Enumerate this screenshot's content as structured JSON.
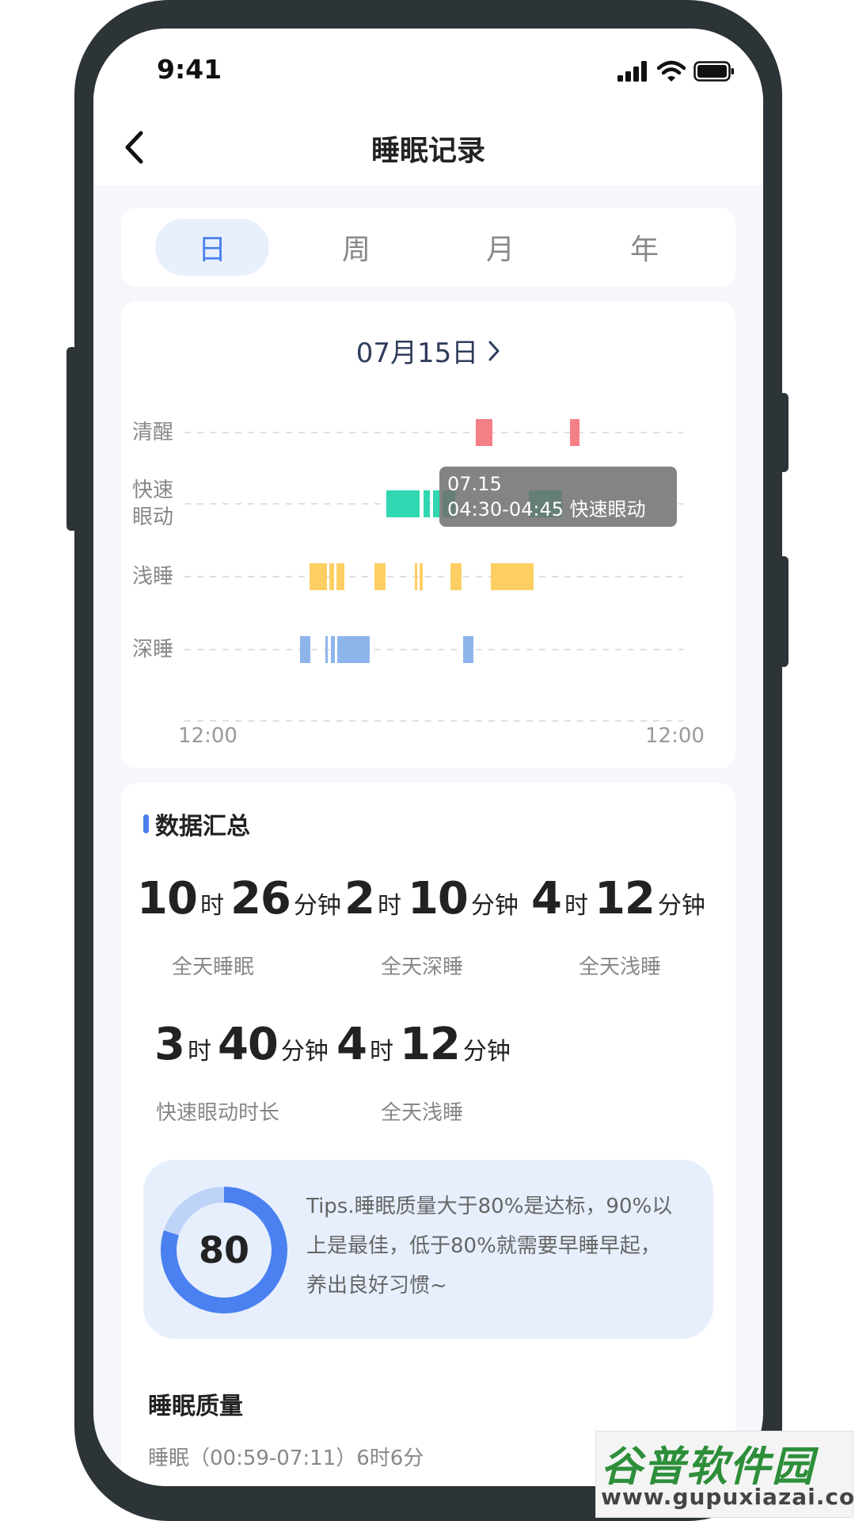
{
  "status_bar": {
    "time": "9:41"
  },
  "nav": {
    "title": "睡眠记录"
  },
  "tabs": [
    {
      "label": "日",
      "active": true
    },
    {
      "label": "周",
      "active": false
    },
    {
      "label": "月",
      "active": false
    },
    {
      "label": "年",
      "active": false
    }
  ],
  "chart": {
    "date_label": "07月15日",
    "row_labels": {
      "awake": "清醒",
      "rem_line1": "快速",
      "rem_line2": "眼动",
      "light": "浅睡",
      "deep": "深睡"
    },
    "x_ticks": {
      "start": "12:00",
      "end": "12:00"
    },
    "tooltip": {
      "date": "07.15",
      "detail": "04:30-04:45 快速眼动"
    },
    "colors": {
      "awake": "#f57f87",
      "rem": "#2fd8b0",
      "light": "#fdcf62",
      "deep": "#8db5ec"
    }
  },
  "summary": {
    "title": "数据汇总",
    "hour_unit": "时",
    "minute_unit": "分钟",
    "stats": [
      {
        "hours": "10",
        "minutes": "26",
        "label": "全天睡眠"
      },
      {
        "hours": "2",
        "minutes": "10",
        "label": "全天深睡"
      },
      {
        "hours": "4",
        "minutes": "12",
        "label": "全天浅睡"
      },
      {
        "hours": "3",
        "minutes": "40",
        "label": "快速眼动时长"
      },
      {
        "hours": "4",
        "minutes": "12",
        "label": "全天浅睡"
      }
    ],
    "score": "80",
    "score_fraction": 0.8,
    "tips_line1": "Tips.睡眠质量大于80%是达标，90%以",
    "tips_line2": "上是最佳，低于80%就需要早睡早起，",
    "tips_line3": "养出良好习惯~",
    "quality_title": "睡眠质量",
    "quality_sub": "睡眠（00:59-07:11）6时6分"
  },
  "watermark": {
    "main": "谷普软件园",
    "url": "www.gupuxiazai.com"
  }
}
